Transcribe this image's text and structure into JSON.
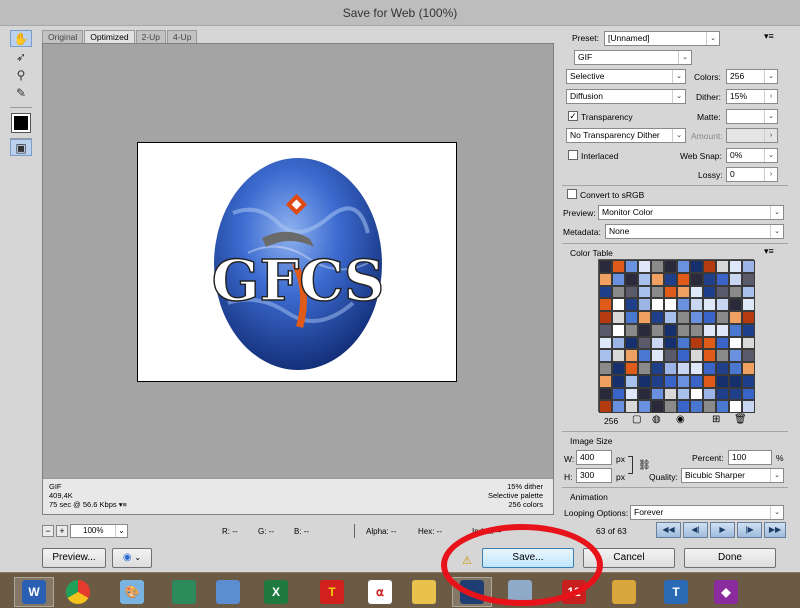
{
  "window": {
    "title": "Save for Web (100%)"
  },
  "tabs": [
    "Original",
    "Optimized",
    "2-Up",
    "4-Up"
  ],
  "image_info": {
    "left": [
      "GIF",
      "409,4K",
      "75 sec @ 56.6 Kbps"
    ],
    "right": [
      "15% dither",
      "Selective palette",
      "256 colors"
    ],
    "logo_text": "GFCS"
  },
  "bottom_bar": {
    "zoom": "100%",
    "readouts": [
      "R: --",
      "G: --",
      "B: --",
      "Alpha: --",
      "Hex: --",
      "Index: --"
    ]
  },
  "buttons": {
    "preview": "Preview...",
    "save": "Save...",
    "cancel": "Cancel",
    "done": "Done"
  },
  "settings": {
    "preset_label": "Preset:",
    "preset_value": "[Unnamed]",
    "format": "GIF",
    "reduction": "Selective",
    "colors_label": "Colors:",
    "colors_value": "256",
    "dither_algo": "Diffusion",
    "dither_label": "Dither:",
    "dither_value": "15%",
    "transparency_label": "Transparency",
    "transparency_checked": true,
    "matte_label": "Matte:",
    "matte_value": "",
    "trans_dither": "No Transparency Dither",
    "amount_label": "Amount:",
    "interlaced_label": "Interlaced",
    "interlaced_checked": false,
    "websnap_label": "Web Snap:",
    "websnap_value": "0%",
    "lossy_label": "Lossy:",
    "lossy_value": "0",
    "convert_srgb_label": "Convert to sRGB",
    "convert_srgb_checked": false,
    "preview_label": "Preview:",
    "preview_value": "Monitor Color",
    "metadata_label": "Metadata:",
    "metadata_value": "None"
  },
  "color_table": {
    "title": "Color Table",
    "count": "256",
    "palette": [
      "#3a64c8",
      "#6a90e0",
      "#1f3f8a",
      "#a8c0ec",
      "#dfe8f8",
      "#ffffff",
      "#d8d8d8",
      "#8a8a8a",
      "#2a2a3a",
      "#e05a1a",
      "#b43a10",
      "#f0a060",
      "#4a78d0",
      "#9cb4e6",
      "#15306c",
      "#c8d6f2",
      "#5a5a6a"
    ]
  },
  "image_size": {
    "title": "Image Size",
    "w_label": "W:",
    "w_value": "400",
    "h_label": "H:",
    "h_value": "300",
    "unit": "px",
    "percent_label": "Percent:",
    "percent_value": "100",
    "percent_unit": "%",
    "quality_label": "Quality:",
    "quality_value": "Bicubic Sharper"
  },
  "animation": {
    "title": "Animation",
    "looping_label": "Looping Options:",
    "looping_value": "Forever",
    "frame_counter": "63 of 63"
  },
  "taskbar": {
    "icons": [
      "word-icon",
      "chrome-icon",
      "paint-icon",
      "presentation-icon",
      "photo-viewer-icon",
      "excel-icon",
      "app-t-icon",
      "pdf-icon",
      "file-explorer-icon",
      "photoshop-icon",
      "window-icon",
      "app-12-icon",
      "archive-icon",
      "app-pin-icon",
      "app-purple-icon"
    ],
    "labels": [
      "W",
      "",
      "",
      "",
      "",
      "X",
      "T",
      "",
      "",
      "",
      "",
      "12",
      "",
      "T",
      ""
    ]
  }
}
